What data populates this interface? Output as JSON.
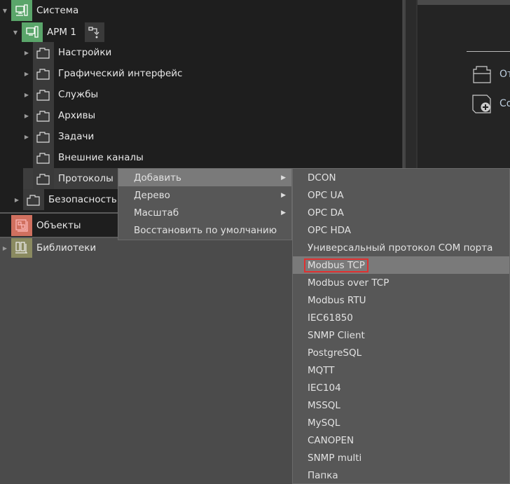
{
  "tree": {
    "root": "Система",
    "arm": "АРМ 1",
    "children": [
      "Настройки",
      "Графический интерфейс",
      "Службы",
      "Архивы",
      "Задачи",
      "Внешние каналы",
      "Протоколы"
    ],
    "security": "Безопасность"
  },
  "sections": {
    "objects": "Объекты",
    "libraries": "Библиотеки"
  },
  "right_panel": {
    "open_label": "От",
    "create_label": "Со"
  },
  "context_menu": {
    "items": [
      {
        "label": "Добавить",
        "submenu": true
      },
      {
        "label": "Дерево",
        "submenu": true
      },
      {
        "label": "Масштаб",
        "submenu": true
      },
      {
        "label": "Восстановить по умолчанию",
        "submenu": false
      }
    ]
  },
  "submenu": {
    "items": [
      "DCON",
      "OPC UA",
      "OPC DA",
      "OPC HDA",
      "Универсальный протокол COM порта",
      "Modbus TCP",
      "Modbus over TCP",
      "Modbus RTU",
      "IEC61850",
      "SNMP Client",
      "PostgreSQL",
      "MQTT",
      "IEC104",
      "MSSQL",
      "MySQL",
      "CANOPEN",
      "SNMP multi",
      "Папка"
    ],
    "highlighted": "Modbus TCP"
  },
  "colors": {
    "system_icon_bg": "#5aa56a",
    "objects_icon_bg": "#d0705f",
    "libraries_icon_bg": "#8a8a60",
    "highlight_box": "#e03030"
  }
}
